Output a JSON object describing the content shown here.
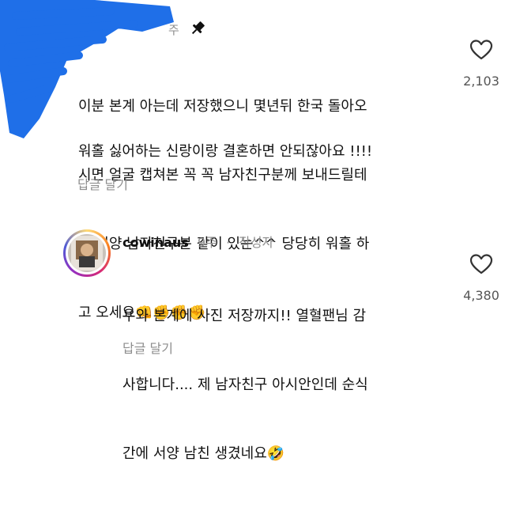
{
  "comments": [
    {
      "time": "주",
      "lines": [
        "이분 본계 아는데 저장했으니 몇년뒤 한국 돌아오",
        "시면 얼굴 캡쳐본 꼭 꼭 남자친구분께 보내드릴테",
        "니 서양 남자친구분 같이 있는^^ 당당히 워홀 하",
        "고 오세요👊✊✊✊"
      ],
      "extra": "워홀 싫어하는 신랑이랑 결혼하면 안되잖아요 !!!!",
      "reply_label": "답글 달기",
      "likes": "2,103"
    },
    {
      "username": "cowinaus",
      "time": "9주",
      "separator": "·",
      "author_badge": "작성자",
      "lines": [
        "우와 본계에 사진 저장까지!! 열혈팬님 감",
        "사합니다.... 제 남자친구 아시안인데 순식",
        "간에 서양 남친 생겼네요🤣"
      ],
      "reply_label": "답글 달기",
      "likes": "4,380"
    }
  ],
  "colors": {
    "redaction": "#1f6fe8",
    "muted": "#8e8e8e",
    "text": "#111111"
  },
  "icons": {
    "pin": "pin-icon",
    "heart": "heart-outline-icon"
  }
}
